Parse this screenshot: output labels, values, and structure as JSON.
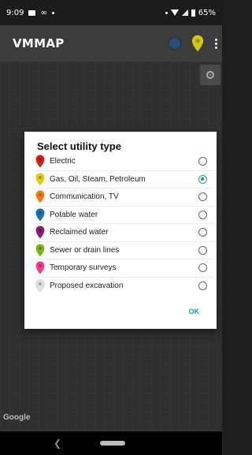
{
  "status_bar": {
    "time": "9:09",
    "battery": "65%"
  },
  "app_bar": {
    "title": "VMMAP",
    "pin_color": "#d4c31c"
  },
  "map": {
    "attribution": "Google"
  },
  "dialog": {
    "title": "Select utility type",
    "ok_label": "OK",
    "accent_color": "#1a9c8c",
    "options": [
      {
        "label": "Electric",
        "pin_color": "#d81e1e",
        "checked": false
      },
      {
        "label": "Gas, Oil, Steam, Petroleum",
        "pin_color": "#e6c619",
        "checked": true
      },
      {
        "label": "Communication, TV",
        "pin_color": "#f07a14",
        "checked": false
      },
      {
        "label": "Potable water",
        "pin_color": "#1a6fb3",
        "checked": false
      },
      {
        "label": "Reclaimed water",
        "pin_color": "#8d1b7a",
        "checked": false
      },
      {
        "label": "Sewer or drain lines",
        "pin_color": "#7cb316",
        "checked": false
      },
      {
        "label": "Temporary surveys",
        "pin_color": "#ee3d8d",
        "checked": false
      },
      {
        "label": "Proposed excavation",
        "pin_color": "#e0e0e0",
        "checked": false
      }
    ]
  }
}
